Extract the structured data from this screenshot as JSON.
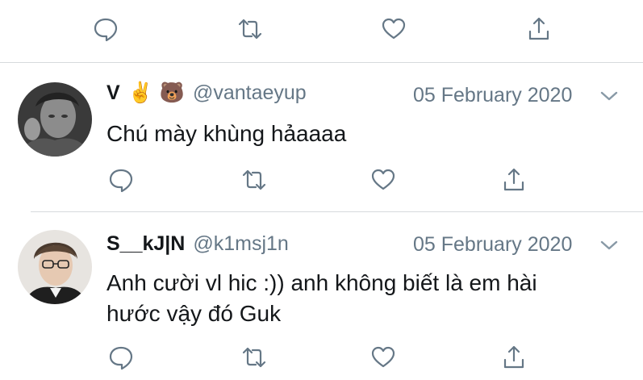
{
  "tweets": [
    {
      "name": "V",
      "emojis": [
        "✌",
        "🐻"
      ],
      "handle": "@vantaeyup",
      "date": "05 February 2020",
      "text_lines": [
        "Chú mày khùng hảaaaa"
      ]
    },
    {
      "name": "S__kJ|N",
      "handle": "@k1msj1n",
      "date": "05 February 2020",
      "text_lines": [
        "Anh cười vl hic :)) anh không biết là em hài",
        "hước vậy đó Guk"
      ]
    }
  ],
  "icons": {
    "reply": "reply-icon",
    "retweet": "retweet-icon",
    "like": "like-icon",
    "share": "share-icon",
    "caret": "chevron-down-icon"
  },
  "colors": {
    "text": "#14171a",
    "muted": "#657786",
    "divider": "#d6dadd"
  }
}
